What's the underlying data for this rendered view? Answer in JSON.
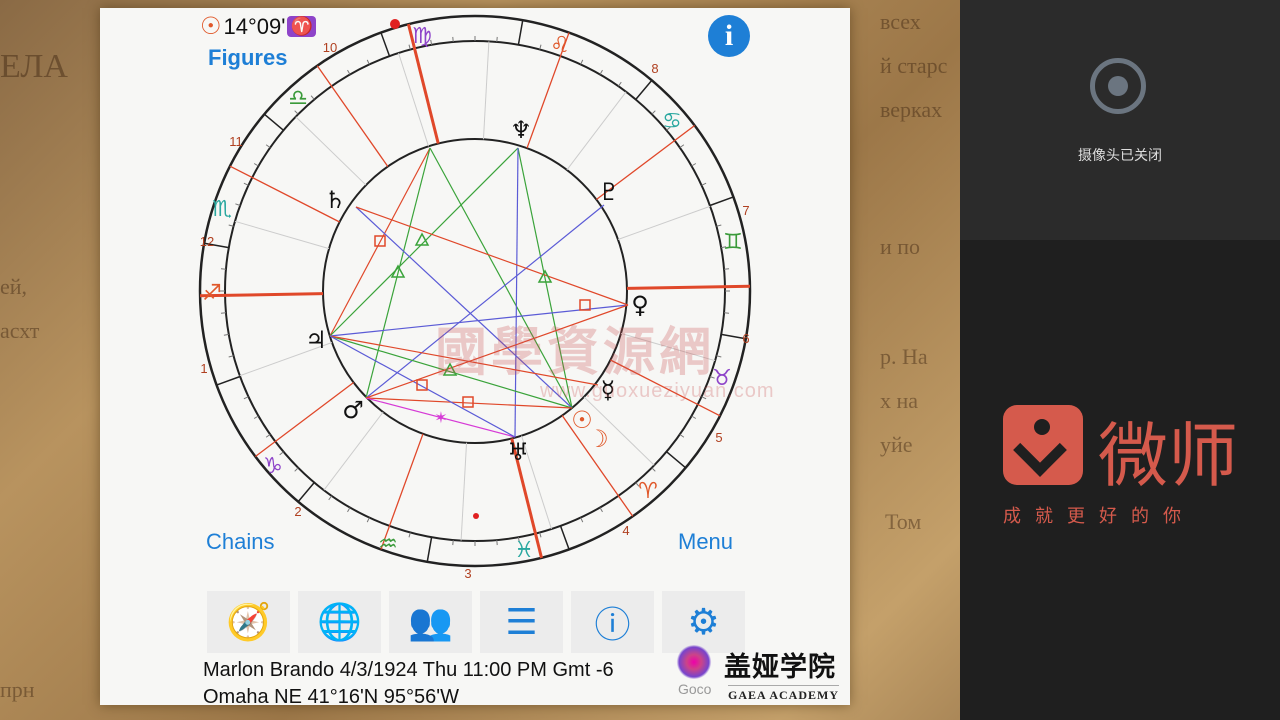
{
  "background_text": [
    "всех",
    "ЕЛА",
    "й старс",
    "верках",
    "ей, ",
    "асхт",
    "р. На",
    "х на",
    "и по",
    "уйе",
    "Том",
    "прн"
  ],
  "chart_app": {
    "sun_position": {
      "icon": "sun-icon",
      "glyph": "☉",
      "degree": "14°09'",
      "sign_glyph": "♈"
    },
    "figures_label": "Figures",
    "chains_label": "Chains",
    "menu_label": "Menu",
    "info_glyph": "i",
    "zodiac": [
      "♍",
      "♌",
      "♋",
      "♊",
      "♉",
      "♈",
      "♓",
      "♒",
      "♑",
      "♐",
      "♏",
      "♎"
    ],
    "houses": [
      "10",
      "8",
      "11",
      "7",
      "12",
      "6",
      "1",
      "5",
      "2",
      "4",
      "3"
    ],
    "planets": [
      {
        "name": "neptune",
        "glyph": "♆"
      },
      {
        "name": "pluto",
        "glyph": "♇"
      },
      {
        "name": "saturn",
        "glyph": "♄"
      },
      {
        "name": "venus",
        "glyph": "♀"
      },
      {
        "name": "jupiter",
        "glyph": "♃"
      },
      {
        "name": "mercury",
        "glyph": "☿"
      },
      {
        "name": "mars",
        "glyph": "♂"
      },
      {
        "name": "sun",
        "glyph": "☉"
      },
      {
        "name": "moon",
        "glyph": "☽"
      },
      {
        "name": "uranus",
        "glyph": "♅"
      }
    ],
    "toolbar": [
      {
        "name": "compass",
        "glyph": "🧭"
      },
      {
        "name": "globe",
        "glyph": "🌐"
      },
      {
        "name": "people",
        "glyph": "👥"
      },
      {
        "name": "checklist",
        "glyph": "☰"
      },
      {
        "name": "info",
        "glyph": "ⓘ"
      },
      {
        "name": "settings",
        "glyph": "⚙"
      }
    ],
    "birth_line1": "Marlon Brando 4/3/1924 Thu 11:00 PM Gmt -6",
    "birth_line2": "Omaha NE 41°16'N 95°56'W",
    "colors": {
      "accent": "#1e7fd6",
      "house_line": "#e0482a",
      "aspect_green": "#3aa33a",
      "aspect_blue": "#5b5bd6",
      "aspect_magenta": "#d63ad6"
    }
  },
  "watermark": {
    "text": "國學資源網",
    "url": "www.guoxueziyuan.com"
  },
  "gaea": {
    "cn": "盖娅学院",
    "en": "GAEA ACADEMY",
    "goco": "Goco"
  },
  "right_panel": {
    "camera_status": "摄像头已关闭",
    "brand": "微师",
    "slogan": "成就更好的你",
    "brand_color": "#d55a4c"
  }
}
